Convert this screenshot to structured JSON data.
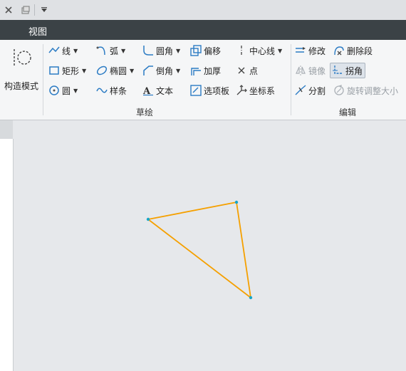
{
  "menu": {
    "tab_view": "视图"
  },
  "construction": {
    "label": "构造模式"
  },
  "sketch_group": {
    "label": "草绘",
    "line": "线",
    "arc": "弧",
    "fillet": "圆角",
    "offset": "偏移",
    "centerline": "中心线",
    "rectangle": "矩形",
    "ellipse": "椭圆",
    "chamfer": "倒角",
    "thicken": "加厚",
    "point": "点",
    "circle": "圆",
    "spline": "样条",
    "text": "文本",
    "palette": "选项板",
    "coordsys": "坐标系"
  },
  "edit_group": {
    "label": "编辑",
    "modify": "修改",
    "delete_segment": "删除段",
    "mirror": "镜像",
    "corner": "拐角",
    "divide": "分割",
    "rotate_resize": "旋转调整大小"
  },
  "colors": {
    "sketch_line": "#f5a000",
    "vertex": "#17a6c8"
  }
}
